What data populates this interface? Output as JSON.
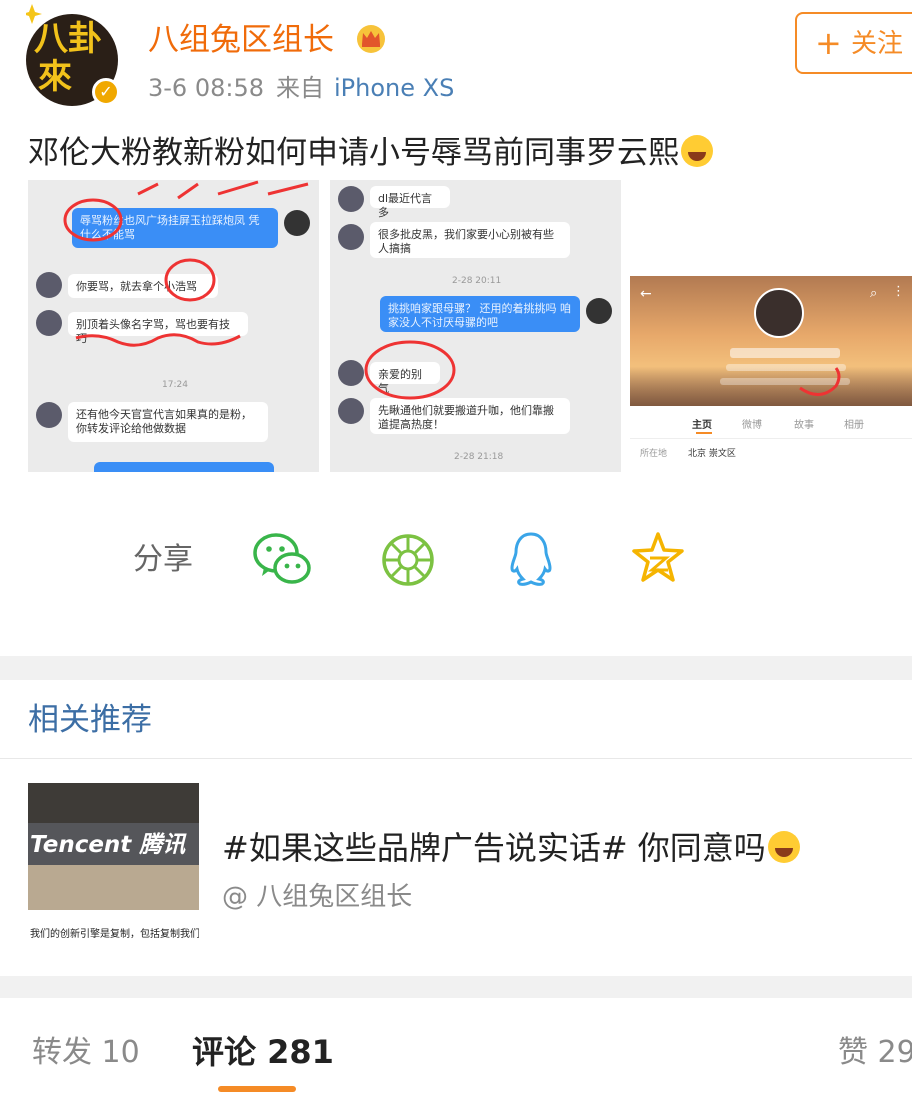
{
  "header": {
    "avatar_text_line1": "八卦",
    "avatar_text_line2": "來",
    "username": "八组兔区组长",
    "post_time": "3-6 08:58",
    "source_label": "来自",
    "source_device": "iPhone XS",
    "follow_plus": "+",
    "follow_label": "关注"
  },
  "post": {
    "text": "邓伦大粉教新粉如何申请小号辱骂前同事罗云熙"
  },
  "images": {
    "img1": {
      "b1": "辱骂粉丝也风广场挂屏玉拉踩炮凤 凭什么不能骂",
      "b2": "你要骂，就去拿个小浩骂",
      "b3": "别顶着头像名字骂，骂也要有技巧",
      "t1": "17:24",
      "b4": "还有他今天官宣代言如果真的是粉，你转发评论给他做数据"
    },
    "img2": {
      "b1": "dl最近代言多",
      "b2": "很多批皮黑，我们家要小心别被有些人搞搞",
      "t1": "2-28 20:11",
      "b3": "挑挑咱家跟母骡？ 还用的着挑挑吗 咱家没人不讨厌母骡的吧",
      "b4": "亲爱的别气",
      "b5": "先瞅通他们就要搬道升咖，他们靠搬道提高热度！",
      "t2": "2-28 21:18"
    },
    "img3": {
      "tab_home": "主页",
      "tab_weibo": "微博",
      "tab_story": "故事",
      "tab_album": "相册",
      "location_label": "所在地",
      "location_value": "北京 崇文区"
    }
  },
  "share": {
    "label": "分享",
    "icons": [
      "wechat-icon",
      "moments-icon",
      "qq-icon",
      "qzone-icon"
    ]
  },
  "related": {
    "title": "相关推荐",
    "item": {
      "thumb_sign": "Tencent 腾讯",
      "thumb_caption": "我们的创新引擎是复制，包括复制我们",
      "title": "#如果这些品牌广告说实话# 你同意吗",
      "author": "@ 八组兔区组长"
    }
  },
  "tabs": {
    "repost": "转发 10",
    "comment": "评论 281",
    "like": "赞 29"
  },
  "colors": {
    "accent": "#f58b26",
    "username": "#f06b0a",
    "link": "#4a7fb5",
    "related_title": "#3c6ea5"
  }
}
